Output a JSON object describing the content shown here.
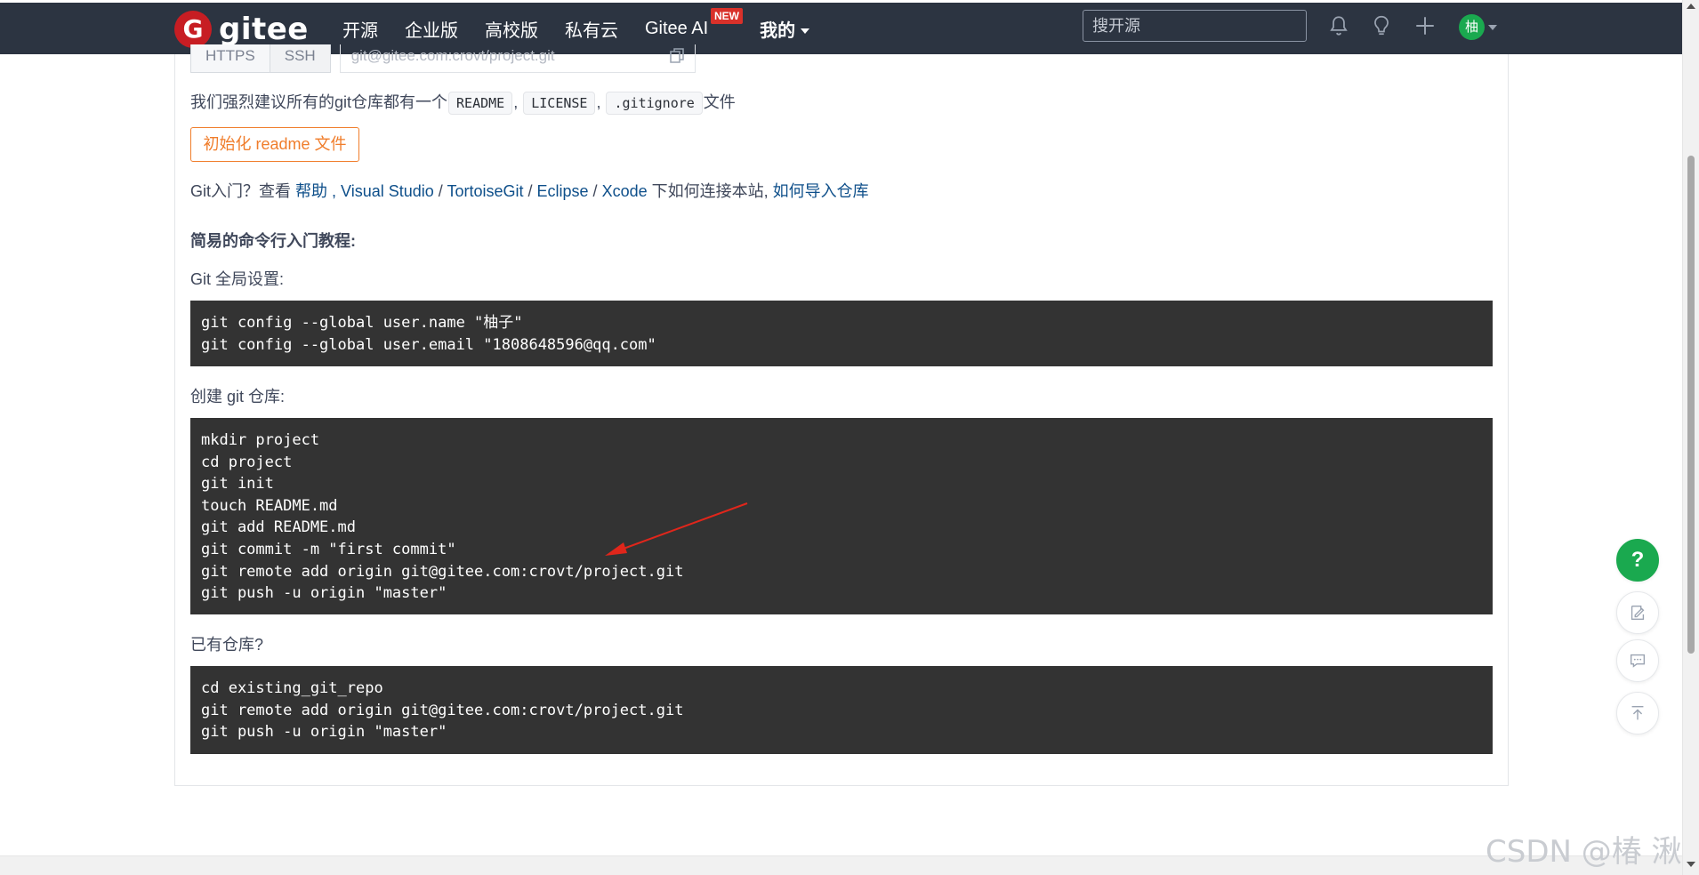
{
  "header": {
    "logo_text": "gitee",
    "logo_glyph": "G",
    "nav": [
      "开源",
      "企业版",
      "高校版",
      "私有云",
      "Gitee AI",
      "我的"
    ],
    "ai_badge": "NEW",
    "search_placeholder": "搜开源",
    "avatar_text": "柚"
  },
  "clone": {
    "https_label": "HTTPS",
    "ssh_label": "SSH",
    "url": "git@gitee.com:crovt/project.git"
  },
  "readme_notice": {
    "prefix": "我们强烈建议所有的git仓库都有一个",
    "files": [
      "README",
      "LICENSE",
      ".gitignore"
    ],
    "sep": ",",
    "suffix": "文件"
  },
  "init_button": "初始化 readme 文件",
  "git_intro": {
    "prefix": "Git入门？查看 ",
    "help": "帮助",
    "comma": " , ",
    "vs": "Visual Studio",
    "slash": " / ",
    "tortoise": "TortoiseGit",
    "eclipse": "Eclipse",
    "xcode": "Xcode",
    "middle": " 下如何连接本站, ",
    "import": "如何导入仓库"
  },
  "tutorial_heading": "简易的命令行入门教程:",
  "global_setup_label": "Git 全局设置:",
  "global_setup_code": "git config --global user.name \"柚子\"\ngit config --global user.email \"1808648596@qq.com\"",
  "create_repo_label": "创建 git 仓库:",
  "create_repo_code": "mkdir project\ncd project\ngit init\ntouch README.md\ngit add README.md\ngit commit -m \"first commit\"\ngit remote add origin git@gitee.com:crovt/project.git\ngit push -u origin \"master\"",
  "existing_repo_label": "已有仓库?",
  "existing_repo_code": "cd existing_git_repo\ngit remote add origin git@gitee.com:crovt/project.git\ngit push -u origin \"master\"",
  "help_fab": "?",
  "icons": {
    "bell": "bell-icon",
    "bulb": "lightbulb-icon",
    "plus": "plus-icon",
    "copy": "copy-icon",
    "edit": "edit-icon",
    "comment": "comment-icon",
    "top": "back-to-top-icon"
  },
  "colors": {
    "nav_bg": "#2c3441",
    "link": "#0e4f8a",
    "accent_orange": "#f07d2b",
    "code_bg": "#333333",
    "help_green": "#1aa94f",
    "annotation_arrow": "#e0261b"
  },
  "watermark": "CSDN @椿  湫"
}
